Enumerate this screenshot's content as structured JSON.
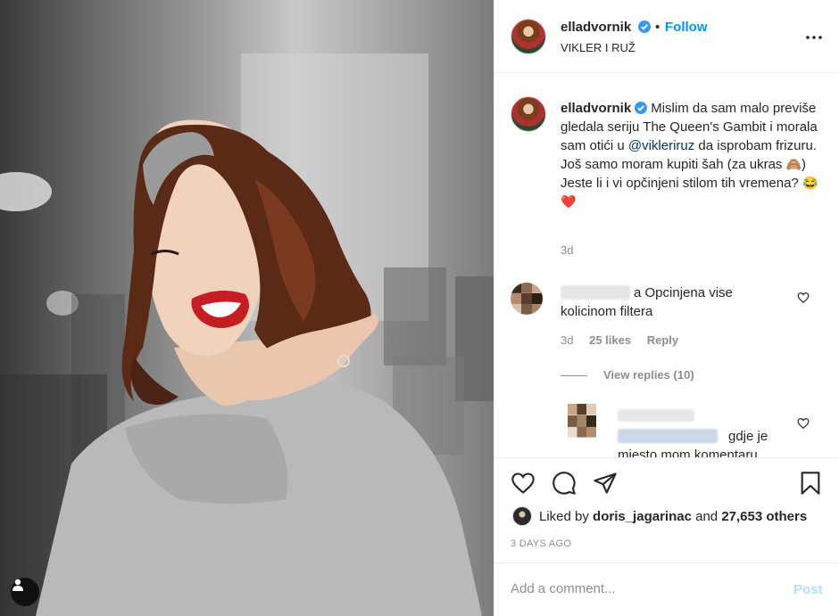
{
  "post": {
    "header": {
      "username": "elladvornik",
      "dot": "•",
      "follow_label": "Follow",
      "location": "VIKLER I RUŽ"
    },
    "caption": {
      "username": "elladvornik",
      "text_part1": "Mislim da sam malo previše gledala seriju The Queen's Gambit i morala sam otići u ",
      "mention": "@vikleriruz",
      "text_part2": " da isprobam frizuru. Još samo moram kupiti šah (za ukras ",
      "emoji_monkey": "🙈",
      "text_part3": ") Jeste li i vi opčinjeni stilom tih vremena? ",
      "emoji_laugh": "😂",
      "emoji_heart": "❤️",
      "time": "3d"
    },
    "comment": {
      "text": "a Opcinjena vise kolicinom filtera",
      "time": "3d",
      "likes": "25 likes",
      "reply_label": "Reply",
      "view_replies": "View replies (10)"
    },
    "reply": {
      "text": "gdje je mjesto mom komentaru"
    },
    "likes": {
      "prefix": "Liked by ",
      "user": "doris_jagarinac",
      "middle": " and ",
      "count": "27,653 others"
    },
    "date": "3 DAYS AGO",
    "comment_box": {
      "placeholder": "Add a comment...",
      "post_label": "Post"
    }
  },
  "icons": {
    "header": [
      "verified-badge-icon",
      "more-options-icon"
    ],
    "actions": [
      "heart-icon",
      "comment-icon",
      "share-icon",
      "bookmark-icon"
    ],
    "photo": [
      "user-tag-icon"
    ]
  },
  "colors": {
    "accent": "#0095f6",
    "mention": "#00376b",
    "muted": "#8e8e8e",
    "post_disabled": "#b2dffc",
    "heart": "#ed4956"
  }
}
